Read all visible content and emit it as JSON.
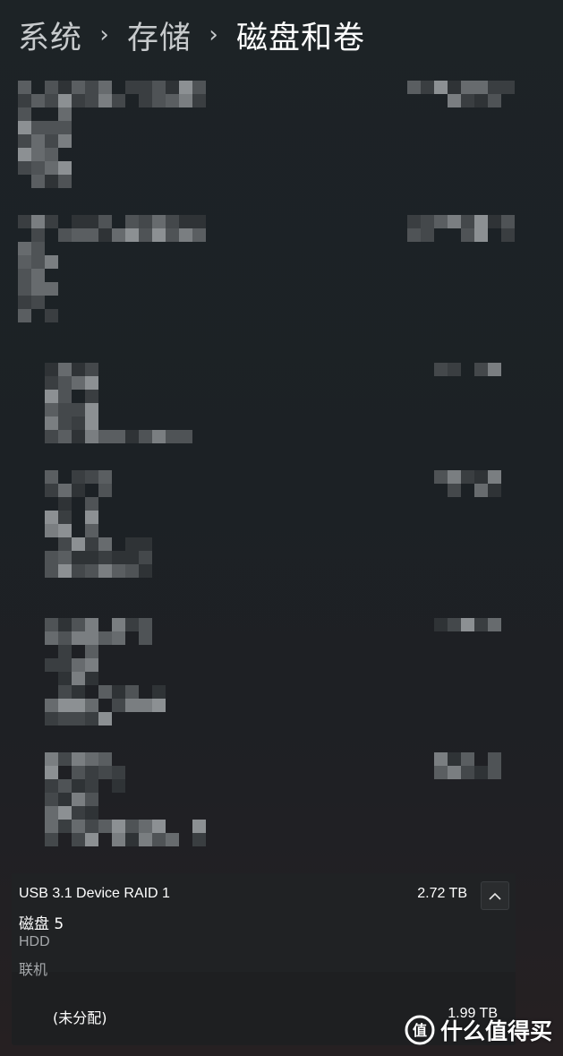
{
  "breadcrumb": {
    "items": [
      "系统",
      "存储",
      "磁盘和卷"
    ],
    "separator": "›"
  },
  "disk": {
    "model": "USB 3.1 Device RAID 1",
    "size": "2.72 TB",
    "name": "磁盘 5",
    "type": "HDD",
    "status": "联机",
    "partition": {
      "label": "(未分配)",
      "size": "1.99 TB"
    }
  },
  "watermark": {
    "text": "什么值得买"
  },
  "colors": {
    "background": "#1d2326",
    "card": "#1e1f21",
    "secondary_text": "#a4a7aa"
  }
}
